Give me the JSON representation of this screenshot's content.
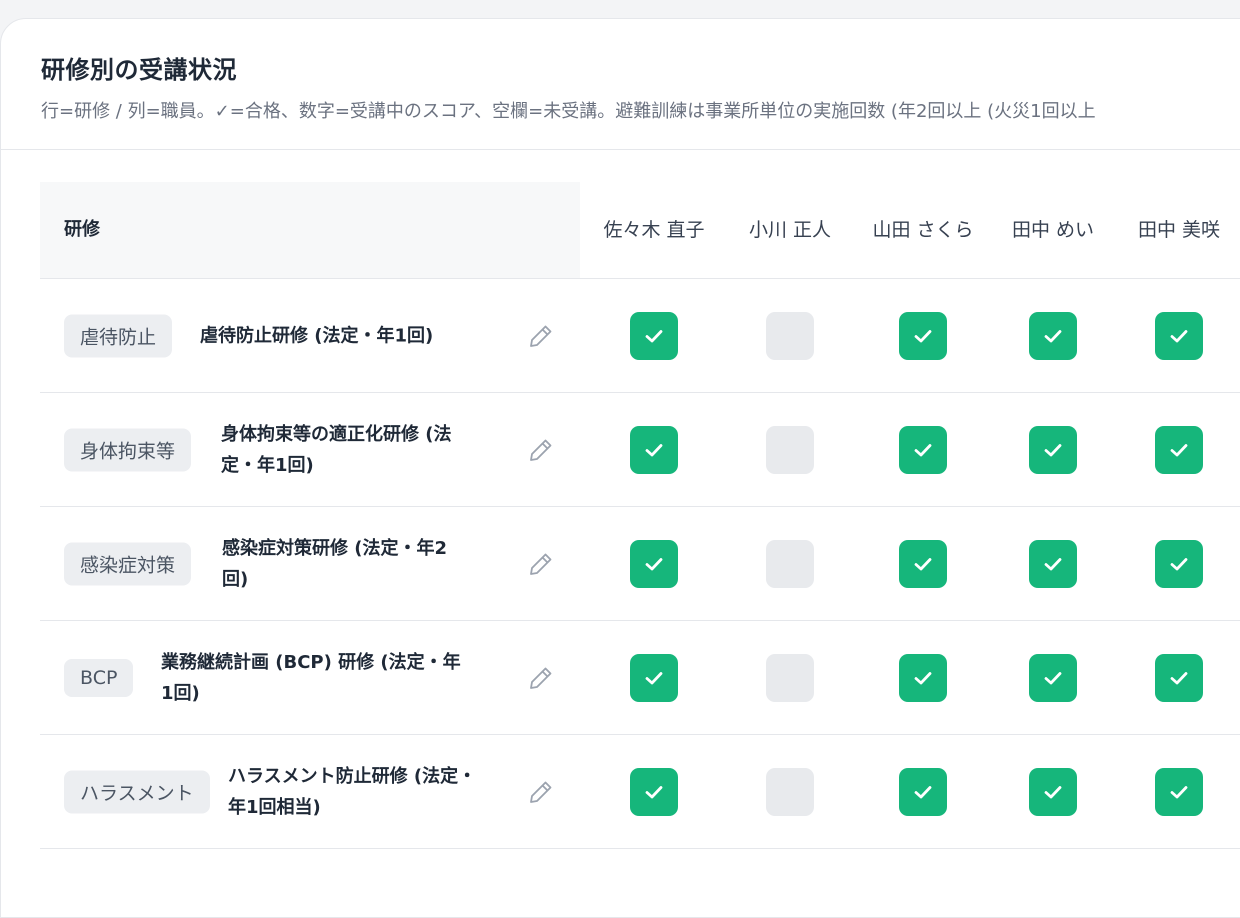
{
  "section": {
    "title": "研修別の受講状況",
    "subtitle": "行=研修 / 列=職員。✓=合格、数字=受講中のスコア、空欄=未受講。避難訓練は事業所単位の実施回数 (年2回以上 (火災1回以上"
  },
  "table": {
    "course_header": "研修",
    "staff": [
      "佐々木 直子",
      "小川 正人",
      "山田 さくら",
      "田中 めい",
      "田中 美咲"
    ],
    "rows": [
      {
        "tag": "虐待防止",
        "name": [
          "虐待防止研修 (法定・年1回)"
        ],
        "status": [
          "passed",
          "empty",
          "passed",
          "passed",
          "passed"
        ]
      },
      {
        "tag": "身体拘束等",
        "name": [
          "身体拘束等の適正化研修 (法",
          "定・年1回)"
        ],
        "status": [
          "passed",
          "empty",
          "passed",
          "passed",
          "passed"
        ]
      },
      {
        "tag": "感染症対策",
        "name": [
          "感染症対策研修 (法定・年2",
          "回)"
        ],
        "status": [
          "passed",
          "empty",
          "passed",
          "passed",
          "passed"
        ]
      },
      {
        "tag": "BCP",
        "name": [
          "業務継続計画 (BCP) 研修 (法定・年",
          "1回)"
        ],
        "status": [
          "passed",
          "empty",
          "passed",
          "passed",
          "passed"
        ]
      },
      {
        "tag": "ハラスメント",
        "name": [
          "ハラスメント防止研修 (法定・",
          "年1回相当)"
        ],
        "status": [
          "passed",
          "empty",
          "passed",
          "passed",
          "passed"
        ]
      }
    ]
  },
  "colors": {
    "passed": "#16b67b",
    "empty": "#e8eaed",
    "tag_bg": "#eceef1"
  },
  "icons": {
    "edit": "pencil-icon",
    "passed": "check-icon"
  }
}
